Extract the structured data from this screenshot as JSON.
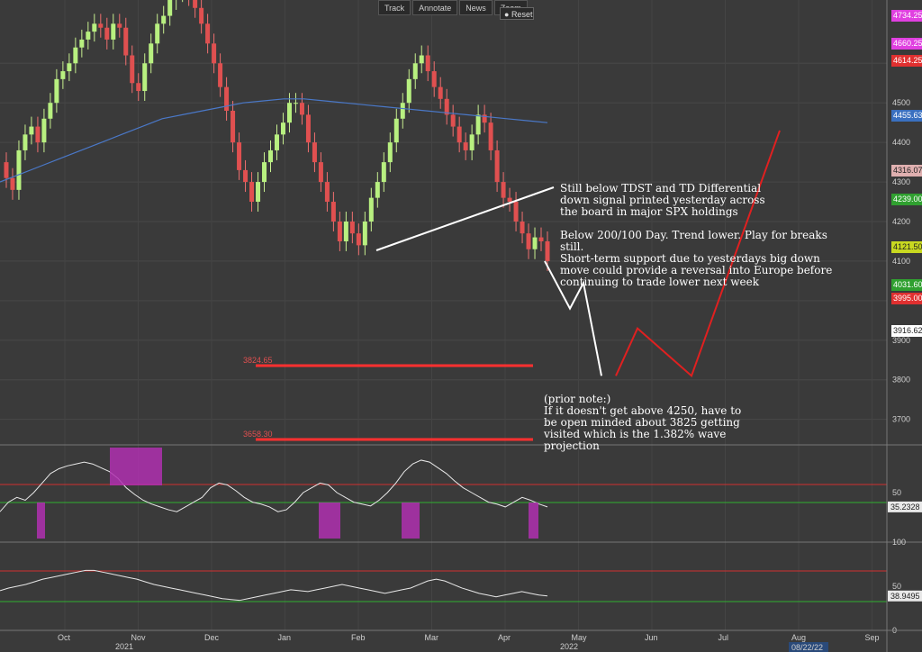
{
  "toolbar": {
    "track_label": "Track",
    "annotate_label": "Annotate",
    "news_label": "News",
    "zoom_label": "Zoom",
    "reset_label": "Reset"
  },
  "annotations": {
    "main_note": "Still below TDST and TD Differential\ndown signal printed yesterday across\nthe board in major SPX holdings\n\nBelow 200/100 Day. Trend lower. Play for breaks still.\nShort-term support due to yesterdays big down\nmove could provide a reversal into Europe before\ncontinuing to trade lower next week",
    "prior_note": "(prior note:)\nIf it doesn't get above 4250, have to\nbe open minded about 3825 getting\nvisited which is the 1.382% wave projection",
    "level_1": "3824.65",
    "level_2": "3658.30"
  },
  "chart_data": {
    "type": "line",
    "instrument_axis": {
      "ticks": [
        4600,
        4500,
        4400,
        4300,
        4200,
        4100,
        4000,
        3900,
        3800,
        3700
      ],
      "ylim": [
        3640,
        4760
      ]
    },
    "price_tags": [
      {
        "value": "4734.25",
        "color": "#e040e0"
      },
      {
        "value": "4660.25",
        "color": "#e040e0"
      },
      {
        "value": "4614.25",
        "color": "#e03030"
      },
      {
        "value": "4455.63",
        "color": "#3a70c0"
      },
      {
        "value": "4316.07",
        "color": "#e0b0b0"
      },
      {
        "value": "4239.00",
        "color": "#30a030"
      },
      {
        "value": "4121.50",
        "color": "#c8d820"
      },
      {
        "value": "4031.60",
        "color": "#30a030"
      },
      {
        "value": "3995.00",
        "color": "#e03030"
      },
      {
        "value": "3916.62",
        "color": "#ffffff"
      }
    ],
    "x_months": [
      "Oct",
      "Nov",
      "Dec",
      "Jan",
      "Feb",
      "Mar",
      "Apr",
      "May",
      "Jun",
      "Jul",
      "Aug",
      "Sep"
    ],
    "x_years": [
      "2021",
      "2022"
    ],
    "date_badge": "08/22/22",
    "price": [
      4350,
      4310,
      4280,
      4380,
      4420,
      4440,
      4400,
      4460,
      4500,
      4560,
      4580,
      4600,
      4640,
      4660,
      4680,
      4700,
      4690,
      4660,
      4700,
      4690,
      4620,
      4550,
      4530,
      4600,
      4650,
      4700,
      4720,
      4760,
      4780,
      4790,
      4770,
      4740,
      4700,
      4650,
      4600,
      4540,
      4480,
      4400,
      4330,
      4300,
      4250,
      4300,
      4350,
      4380,
      4420,
      4450,
      4500,
      4500,
      4470,
      4400,
      4350,
      4300,
      4250,
      4200,
      4150,
      4200,
      4170,
      4140,
      4200,
      4260,
      4300,
      4350,
      4400,
      4460,
      4500,
      4560,
      4600,
      4620,
      4580,
      4540,
      4510,
      4470,
      4440,
      4400,
      4380,
      4420,
      4470,
      4450,
      4380,
      4300,
      4260,
      4250,
      4200,
      4170,
      4130,
      4160,
      4150,
      4100
    ],
    "sma_line": [
      4300,
      4320,
      4340,
      4360,
      4380,
      4400,
      4420,
      4440,
      4460,
      4470,
      4480,
      4490,
      4500,
      4505,
      4510,
      4510,
      4505,
      4500,
      4495,
      4490,
      4485,
      4480,
      4475,
      4470,
      4465,
      4460,
      4455,
      4450
    ],
    "projection": {
      "white": [
        [
          "cur",
          4100
        ],
        [
          "a",
          3980
        ],
        [
          "b",
          4045
        ],
        [
          "c",
          3810
        ]
      ],
      "red": [
        [
          "c",
          3810
        ],
        [
          "d",
          3930
        ],
        [
          "e",
          3810
        ],
        [
          "f",
          4430
        ]
      ]
    },
    "levels": [
      3824.65,
      3658.3
    ],
    "indicator_1": {
      "ticks": [
        50
      ],
      "readout": "35.2328",
      "upper": 70,
      "lower": 45,
      "values": [
        30,
        40,
        45,
        42,
        50,
        60,
        70,
        75,
        78,
        80,
        82,
        80,
        76,
        72,
        65,
        55,
        48,
        42,
        38,
        35,
        32,
        30,
        35,
        40,
        45,
        55,
        60,
        58,
        52,
        45,
        40,
        38,
        35,
        30,
        32,
        40,
        50,
        55,
        60,
        58,
        50,
        45,
        40,
        38,
        36,
        42,
        50,
        60,
        72,
        80,
        84,
        82,
        76,
        70,
        62,
        55,
        50,
        45,
        40,
        38,
        35,
        40,
        45,
        42,
        38,
        35
      ]
    },
    "indicator_2": {
      "ticks": [
        100,
        50,
        0
      ],
      "readout": "38.9495",
      "upper": 70,
      "lower": 30,
      "values": [
        45,
        48,
        50,
        52,
        55,
        58,
        60,
        62,
        64,
        66,
        68,
        68,
        66,
        64,
        62,
        60,
        58,
        55,
        52,
        50,
        48,
        46,
        44,
        42,
        40,
        38,
        36,
        35,
        34,
        36,
        38,
        40,
        42,
        44,
        46,
        45,
        44,
        46,
        48,
        50,
        52,
        50,
        48,
        46,
        44,
        42,
        44,
        46,
        48,
        52,
        56,
        58,
        56,
        52,
        48,
        45,
        42,
        40,
        38,
        40,
        42,
        44,
        42,
        40,
        39
      ]
    }
  }
}
